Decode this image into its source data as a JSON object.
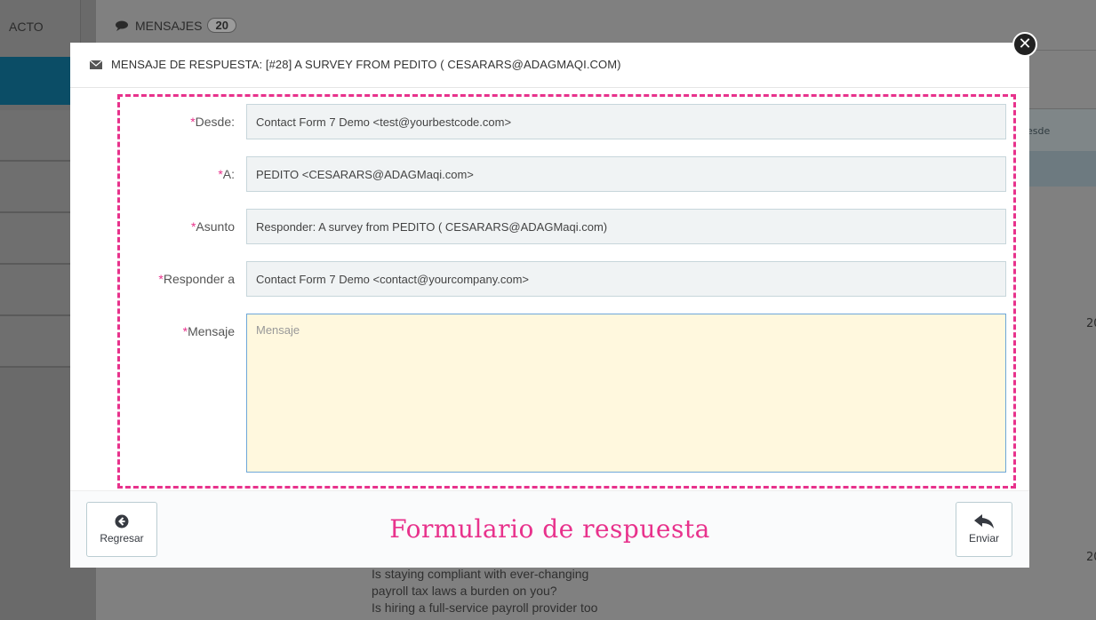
{
  "background": {
    "left_tab": "ACTO",
    "mensajes_label": "MENSAJES",
    "mensajes_count": "20",
    "column_header": "esde",
    "numbers": [
      "20",
      "20"
    ],
    "body_lines": [
      "Is staying compliant with ever-changing",
      "payroll tax laws a burden on you?",
      "Is hiring a full-service payroll provider too"
    ]
  },
  "modal": {
    "title": "MENSAJE DE RESPUESTA: [#28] A SURVEY FROM PEDITO ( CESARARS@ADAGMAQI.COM)",
    "close_glyph": "✕",
    "fields": {
      "desde": {
        "label": "Desde:",
        "value": "Contact Form 7 Demo <test@yourbestcode.com>"
      },
      "a": {
        "label": "A:",
        "value": "PEDITO <CESARARS@ADAGMaqi.com>"
      },
      "asunto": {
        "label": "Asunto",
        "value": "Responder: A survey from PEDITO ( CESARARS@ADAGMaqi.com)"
      },
      "responder_a": {
        "label": "Responder a",
        "value": "Contact Form 7 Demo <contact@yourcompany.com>"
      },
      "mensaje": {
        "label": "Mensaje",
        "placeholder": "Mensaje"
      }
    },
    "required_mark": "*",
    "footer": {
      "back_label": "Regresar",
      "send_label": "Enviar",
      "caption": "Formulario de respuesta"
    }
  },
  "colors": {
    "accent_pink": "#e8328c",
    "sidebar_active": "#0b4d66",
    "textarea_bg": "#fff8de"
  },
  "icons": [
    "envelope-icon",
    "close-icon",
    "arrow-left-circle-icon",
    "reply-icon",
    "comments-icon"
  ]
}
